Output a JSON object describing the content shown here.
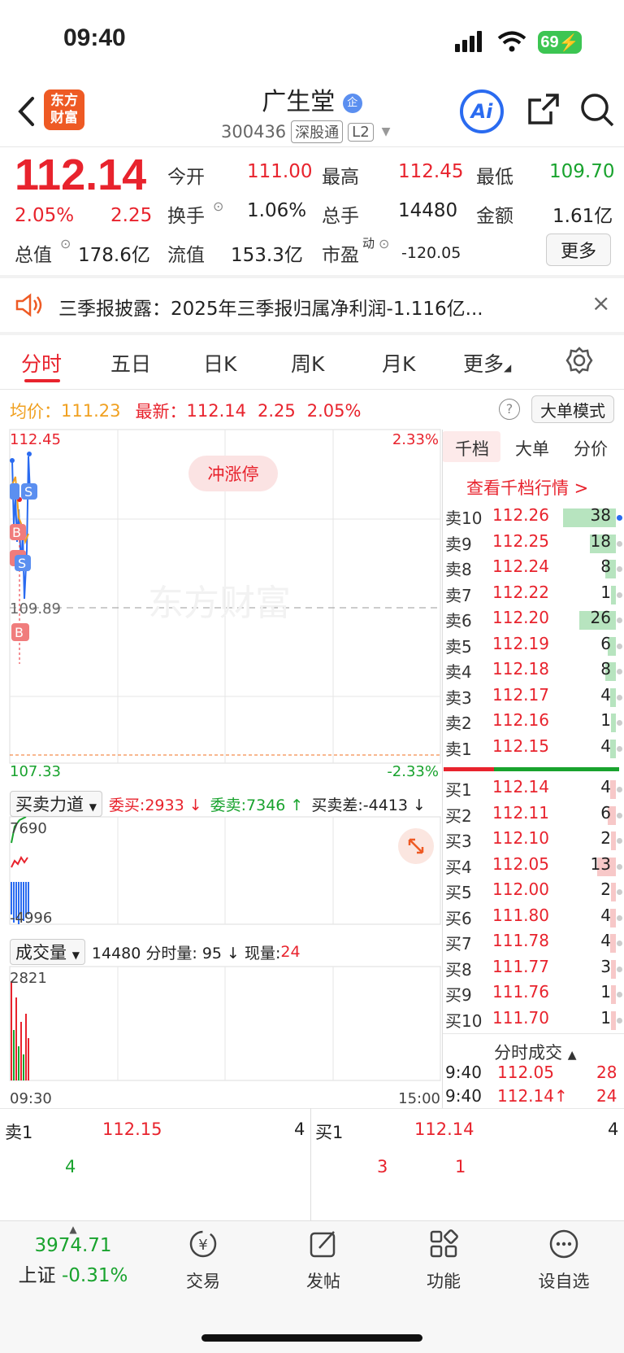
{
  "status": {
    "time": "09:40",
    "battery": "69"
  },
  "header": {
    "logo_line1": "东方",
    "logo_line2": "财富",
    "name": "广生堂",
    "badge": "企",
    "code": "300436",
    "tag1": "深股通",
    "tag2": "L2",
    "ai_label": "Ai"
  },
  "quote": {
    "price": "112.14",
    "change_pct": "2.05%",
    "change": "2.25",
    "open_label": "今开",
    "open": "111.00",
    "high_label": "最高",
    "high": "112.45",
    "low_label": "最低",
    "low": "109.70",
    "turnover_label": "换手",
    "turnover": "1.06%",
    "volume_label": "总手",
    "volume": "14480",
    "amount_label": "金额",
    "amount": "1.61亿",
    "mktcap_label": "总值",
    "mktcap": "178.6亿",
    "float_label": "流值",
    "float": "153.3亿",
    "pe_label": "市盈",
    "pe_sup": "动",
    "pe": "-120.05",
    "more_label": "更多"
  },
  "notice": {
    "text": "三季报披露：2025年三季报归属净利润-1.116亿..."
  },
  "tabs": [
    "分时",
    "五日",
    "日K",
    "周K",
    "月K",
    "更多"
  ],
  "info": {
    "avg_label": "均价：",
    "avg": "111.23",
    "latest_label": "最新：",
    "latest": "112.14",
    "chg": "2.25",
    "pct": "2.05%",
    "bigorder_label": "大单模式"
  },
  "chart": {
    "high_label": "112.45",
    "high_pct": "2.33%",
    "mid_label": "109.89",
    "low_label": "107.33",
    "low_pct": "-2.33%",
    "limitup_label": "冲涨停",
    "watermark": "东方财富",
    "start_time": "09:30",
    "end_time": "15:00",
    "force_selector": "买卖力道",
    "force_buy": "委买:2933 ↓",
    "force_sell": "委卖:7346 ↑",
    "force_diff": "买卖差:-4413 ↓",
    "force_max": "7690",
    "force_min": "-4996",
    "volume_selector": "成交量",
    "volume_info": "14480 分时量: 95 ↓ 现量: ",
    "volume_now": "24",
    "volume_max": "2821",
    "markers_s": "S",
    "markers_b": "B"
  },
  "book": {
    "tabs": [
      "千档",
      "大单",
      "分价"
    ],
    "link": "查看千档行情 >",
    "asks": [
      {
        "label": "卖10",
        "price": "112.26",
        "vol": "38",
        "bar": 0.9
      },
      {
        "label": "卖9",
        "price": "112.25",
        "vol": "18",
        "bar": 0.45
      },
      {
        "label": "卖8",
        "price": "112.24",
        "vol": "8",
        "bar": 0.18
      },
      {
        "label": "卖7",
        "price": "112.22",
        "vol": "1",
        "bar": 0.03
      },
      {
        "label": "卖6",
        "price": "112.20",
        "vol": "26",
        "bar": 0.62
      },
      {
        "label": "卖5",
        "price": "112.19",
        "vol": "6",
        "bar": 0.14
      },
      {
        "label": "卖4",
        "price": "112.18",
        "vol": "8",
        "bar": 0.18
      },
      {
        "label": "卖3",
        "price": "112.17",
        "vol": "4",
        "bar": 0.1
      },
      {
        "label": "卖2",
        "price": "112.16",
        "vol": "1",
        "bar": 0.03
      },
      {
        "label": "卖1",
        "price": "112.15",
        "vol": "4",
        "bar": 0.1
      }
    ],
    "bids": [
      {
        "label": "买1",
        "price": "112.14",
        "vol": "4",
        "bar": 0.1
      },
      {
        "label": "买2",
        "price": "112.11",
        "vol": "6",
        "bar": 0.14
      },
      {
        "label": "买3",
        "price": "112.10",
        "vol": "2",
        "bar": 0.05
      },
      {
        "label": "买4",
        "price": "112.05",
        "vol": "13",
        "bar": 0.32
      },
      {
        "label": "买5",
        "price": "112.00",
        "vol": "2",
        "bar": 0.05
      },
      {
        "label": "买6",
        "price": "111.80",
        "vol": "4",
        "bar": 0.1
      },
      {
        "label": "买7",
        "price": "111.78",
        "vol": "4",
        "bar": 0.1
      },
      {
        "label": "买8",
        "price": "111.77",
        "vol": "3",
        "bar": 0.07
      },
      {
        "label": "买9",
        "price": "111.76",
        "vol": "1",
        "bar": 0.03
      },
      {
        "label": "买10",
        "price": "111.70",
        "vol": "1",
        "bar": 0.03
      }
    ],
    "trades_title": "分时成交",
    "trades": [
      {
        "time": "9:40",
        "price": "112.05",
        "vol": "28"
      },
      {
        "time": "9:40",
        "price": "112.14↑",
        "vol": "24"
      }
    ]
  },
  "level1": {
    "ask_label": "卖1",
    "ask_price": "112.15",
    "ask_vol": "4",
    "ask_sub": "4",
    "bid_label": "买1",
    "bid_price": "112.14",
    "bid_vol": "4",
    "bid_sub1": "3",
    "bid_sub2": "1"
  },
  "nav": {
    "index_value": "3974.71",
    "index_name": "上证",
    "index_pct": "-0.31%",
    "items": [
      "交易",
      "发帖",
      "功能",
      "设自选"
    ]
  }
}
